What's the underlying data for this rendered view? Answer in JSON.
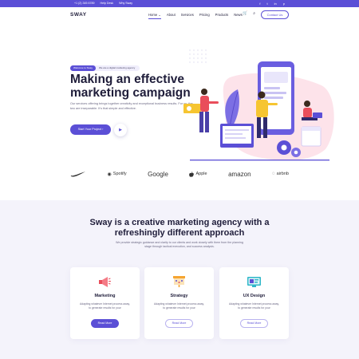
{
  "topbar": {
    "phone": "+1 (2) 345 6789",
    "link1": "Help Desk",
    "link2": "Why Sway",
    "social": [
      "f",
      "t",
      "in",
      "p"
    ]
  },
  "header": {
    "logo": "SWAY",
    "nav": [
      "Home ⌄",
      "About",
      "Services",
      "Pricing",
      "Products",
      "News"
    ],
    "cart_icon": "🛒",
    "search_icon": "⌕",
    "contact_label": "Contact Us"
  },
  "hero": {
    "tag_pill": "Welcome to Sway",
    "tag_text": "We are a digital marketing agency",
    "title": "Making an effective marketing campaign",
    "description": "Our services offering brings together creativity and exceptional business results. For us, the two are inseparable. It's that simple and effective.",
    "start_label": "Start Your Project ›",
    "play_icon": "▶"
  },
  "brands": [
    {
      "icon": "",
      "name": "NIKE-swoosh"
    },
    {
      "icon": "◉",
      "name": "Spotify"
    },
    {
      "icon": "",
      "name": "Google"
    },
    {
      "icon": "",
      "name": "Apple"
    },
    {
      "icon": "",
      "name": "amazon"
    },
    {
      "icon": "◌",
      "name": "airbnb"
    }
  ],
  "about": {
    "title": "Sway is a creative marketing agency with a refreshingly different approach",
    "description": "We provide strategic guidance and clarity to our clients and work closely with them from the planning stage through tactical execution, and success analysis."
  },
  "cards": [
    {
      "title": "Marketing",
      "description": "Adapting whatever Internet process away, to generate results for your",
      "button": "Read More",
      "style": "solid"
    },
    {
      "title": "Strategy",
      "description": "Adapting whatever Internet process away, to generate results for your",
      "button": "Read More",
      "style": "outline"
    },
    {
      "title": "UX Design",
      "description": "Adapting whatever Internet process away, to generate results for your",
      "button": "Read More",
      "style": "outline"
    }
  ],
  "colors": {
    "accent": "#5b4fd6",
    "section_bg": "#f4f3fb",
    "illustration_pink": "#fde3ea",
    "illustration_yellow": "#f6c531"
  }
}
